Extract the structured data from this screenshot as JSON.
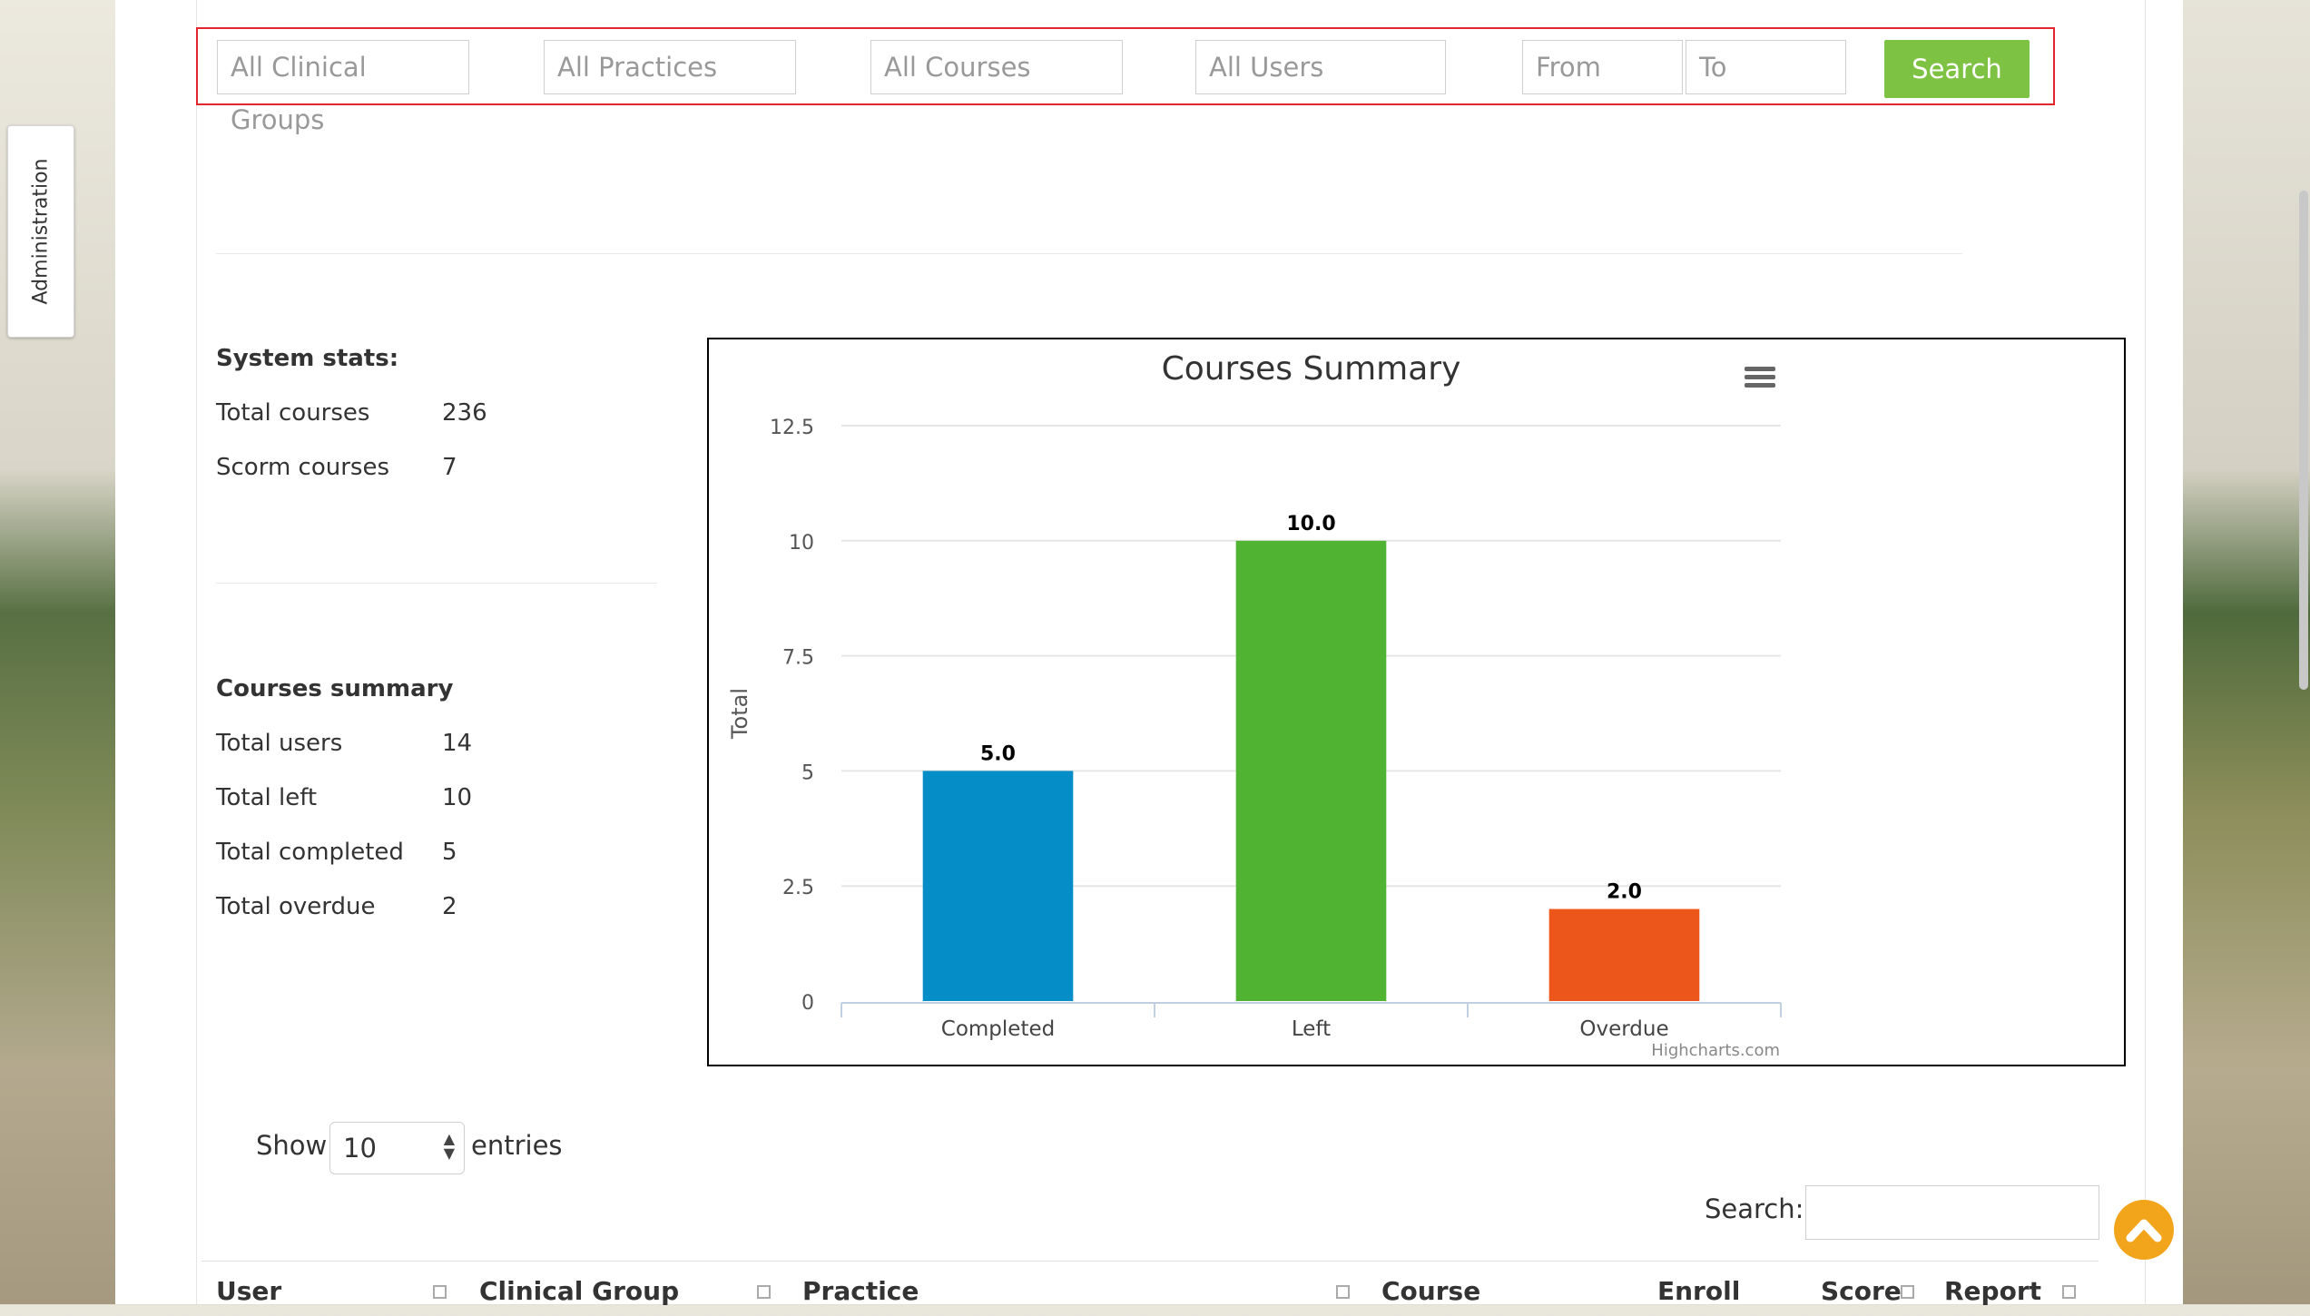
{
  "sidebar": {
    "admin_tab_label": "Administration"
  },
  "filters": {
    "clinical_groups_placeholder": "All Clinical Groups",
    "practices_placeholder": "All Practices",
    "courses_placeholder": "All Courses",
    "users_placeholder": "All Users",
    "from_placeholder": "From",
    "to_placeholder": "To",
    "search_button": "Search"
  },
  "system_stats": {
    "title": "System stats:",
    "rows": [
      {
        "label": "Total courses",
        "value": "236"
      },
      {
        "label": "Scorm courses",
        "value": "7"
      }
    ]
  },
  "courses_summary": {
    "title": "Courses summary",
    "rows": [
      {
        "label": "Total users",
        "value": "14"
      },
      {
        "label": "Total left",
        "value": "10"
      },
      {
        "label": "Total completed",
        "value": "5"
      },
      {
        "label": "Total overdue",
        "value": "2"
      }
    ]
  },
  "chart_data": {
    "type": "bar",
    "title": "Courses Summary",
    "xlabel": "",
    "ylabel": "Total",
    "categories": [
      "Completed",
      "Left",
      "Overdue"
    ],
    "values": [
      5.0,
      10.0,
      2.0
    ],
    "data_labels": [
      "5.0",
      "10.0",
      "2.0"
    ],
    "colors": [
      "#058dc7",
      "#50b432",
      "#ed561b"
    ],
    "ylim": [
      0,
      12.5
    ],
    "yticks": [
      "0",
      "2.5",
      "5",
      "7.5",
      "10",
      "12.5"
    ],
    "ytick_values": [
      0,
      2.5,
      5,
      7.5,
      10,
      12.5
    ],
    "grid": true,
    "credits": "Highcharts.com",
    "menu_icon": "hamburger-menu-icon"
  },
  "table": {
    "show_label": "Show",
    "entries_value": "10",
    "entries_label": "entries",
    "search_label": "Search:",
    "columns": [
      "User",
      "Clinical Group",
      "Practice",
      "Course",
      "Enroll",
      "Score",
      "Report"
    ]
  },
  "colors": {
    "accent_green": "#7dc242",
    "filter_border": "#e3262d",
    "scroll_top": "#f2a51a"
  }
}
